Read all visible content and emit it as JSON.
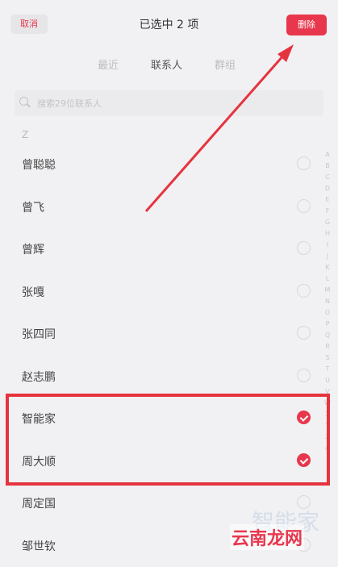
{
  "topbar": {
    "cancel_label": "取消",
    "title": "已选中 2 项",
    "delete_label": "删除"
  },
  "tabs": [
    {
      "label": "最近",
      "active": false
    },
    {
      "label": "联系人",
      "active": true
    },
    {
      "label": "群组",
      "active": false
    }
  ],
  "search": {
    "placeholder": "搜索29位联系人"
  },
  "section_letter": "Z",
  "contacts": [
    {
      "name": "曾聪聪",
      "selected": false
    },
    {
      "name": "曾飞",
      "selected": false
    },
    {
      "name": "曾辉",
      "selected": false
    },
    {
      "name": "张嘎",
      "selected": false
    },
    {
      "name": "张四同",
      "selected": false
    },
    {
      "name": "赵志鹏",
      "selected": false
    },
    {
      "name": "智能家",
      "selected": true
    },
    {
      "name": "周大顺",
      "selected": true
    },
    {
      "name": "周定国",
      "selected": false
    },
    {
      "name": "邹世钦",
      "selected": false
    }
  ],
  "index_letters": [
    "A",
    "B",
    "C",
    "D",
    "E",
    "F",
    "G",
    "H",
    "I",
    "J",
    "K",
    "L",
    "M",
    "N",
    "O",
    "P",
    "Q",
    "R",
    "S",
    "T",
    "U",
    "V",
    "W",
    "X",
    "Y",
    "Z",
    "#"
  ],
  "colors": {
    "accent": "#e8374d",
    "highlight_box": "#e5343f"
  },
  "watermark": {
    "faint_text": "智能家",
    "site_text": "云南龙网"
  }
}
